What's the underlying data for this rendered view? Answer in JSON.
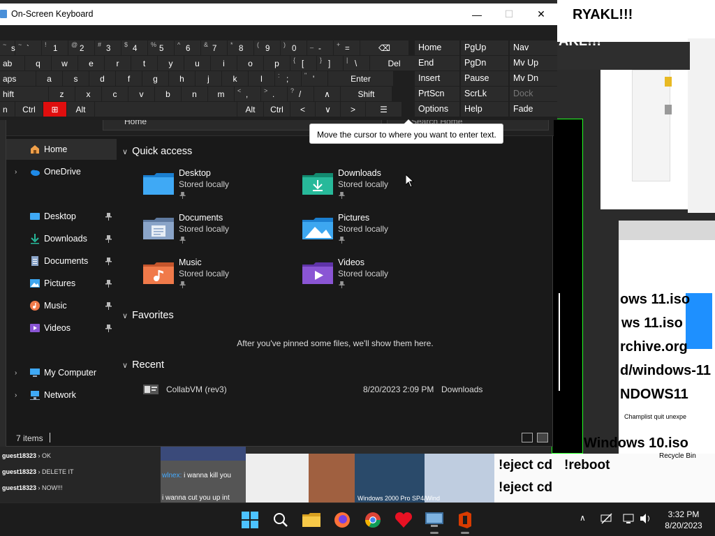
{
  "osk": {
    "title": "On-Screen Keyboard",
    "minimize": "—",
    "maximize": "☐",
    "close": "✕",
    "rows": [
      [
        {
          "s": "~",
          "m": "sc",
          "left": true
        },
        {
          "s": "~",
          "m": "`"
        },
        {
          "s": "!",
          "m": "1"
        },
        {
          "s": "@",
          "m": "2"
        },
        {
          "s": "#",
          "m": "3"
        },
        {
          "s": "$",
          "m": "4"
        },
        {
          "s": "%",
          "m": "5"
        },
        {
          "s": "^",
          "m": "6"
        },
        {
          "s": "&",
          "m": "7"
        },
        {
          "s": "*",
          "m": "8"
        },
        {
          "s": "(",
          "m": "9"
        },
        {
          "s": ")",
          "m": "0"
        },
        {
          "s": "_",
          "m": "-"
        },
        {
          "s": "+",
          "m": "="
        },
        {
          "s": "",
          "m": "⌫"
        }
      ],
      [
        {
          "s": "",
          "m": "ab",
          "left": true
        },
        {
          "s": "",
          "m": "q"
        },
        {
          "s": "",
          "m": "w"
        },
        {
          "s": "",
          "m": "e"
        },
        {
          "s": "",
          "m": "r"
        },
        {
          "s": "",
          "m": "t"
        },
        {
          "s": "",
          "m": "y"
        },
        {
          "s": "",
          "m": "u"
        },
        {
          "s": "",
          "m": "i"
        },
        {
          "s": "",
          "m": "o"
        },
        {
          "s": "",
          "m": "p"
        },
        {
          "s": "{",
          "m": "["
        },
        {
          "s": "}",
          "m": "]"
        },
        {
          "s": "|",
          "m": "\\"
        },
        {
          "s": "",
          "m": "Del"
        }
      ],
      [
        {
          "s": "",
          "m": "aps",
          "left": true
        },
        {
          "s": "",
          "m": "a"
        },
        {
          "s": "",
          "m": "s"
        },
        {
          "s": "",
          "m": "d"
        },
        {
          "s": "",
          "m": "f"
        },
        {
          "s": "",
          "m": "g"
        },
        {
          "s": "",
          "m": "h"
        },
        {
          "s": "",
          "m": "j"
        },
        {
          "s": "",
          "m": "k"
        },
        {
          "s": "",
          "m": "l"
        },
        {
          "s": ":",
          "m": ";"
        },
        {
          "s": "\"",
          "m": "'"
        },
        {
          "s": "",
          "m": "Enter"
        }
      ],
      [
        {
          "s": "",
          "m": "hift",
          "left": true
        },
        {
          "s": "",
          "m": "z"
        },
        {
          "s": "",
          "m": "x"
        },
        {
          "s": "",
          "m": "c"
        },
        {
          "s": "",
          "m": "v"
        },
        {
          "s": "",
          "m": "b"
        },
        {
          "s": "",
          "m": "n"
        },
        {
          "s": "",
          "m": "m"
        },
        {
          "s": "<",
          "m": ","
        },
        {
          "s": ">",
          "m": "."
        },
        {
          "s": "?",
          "m": "/"
        },
        {
          "s": "",
          "m": "∧"
        },
        {
          "s": "",
          "m": "Shift"
        }
      ],
      [
        {
          "s": "",
          "m": "n",
          "left": true
        },
        {
          "s": "",
          "m": "Ctrl"
        },
        {
          "s": "",
          "m": "⊞"
        },
        {
          "s": "",
          "m": "Alt"
        },
        {
          "s": "",
          "m": ""
        },
        {
          "s": "",
          "m": "Alt"
        },
        {
          "s": "",
          "m": "Ctrl"
        },
        {
          "s": "",
          "m": "<"
        },
        {
          "s": "",
          "m": "∨"
        },
        {
          "s": "",
          "m": ">"
        },
        {
          "s": "",
          "m": "☰"
        }
      ]
    ],
    "nav": [
      [
        "Home",
        "PgUp",
        "Nav"
      ],
      [
        "End",
        "PgDn",
        "Mv Up"
      ],
      [
        "Insert",
        "Pause",
        "Mv Dn"
      ],
      [
        "PrtScn",
        "ScrLk",
        "Dock"
      ],
      [
        "Options",
        "Help",
        "Fade"
      ]
    ],
    "tooltip": "Move the cursor to where you want to enter text."
  },
  "explorer": {
    "address": "Home",
    "search_placeholder": "Search Home",
    "nav": {
      "home": "Home",
      "onedrive": "OneDrive",
      "desktop": "Desktop",
      "downloads": "Downloads",
      "documents": "Documents",
      "pictures": "Pictures",
      "music": "Music",
      "videos": "Videos",
      "my_computer": "My Computer",
      "network": "Network"
    },
    "quick_access_header": "Quick access",
    "quick_access": [
      {
        "name": "Desktop",
        "sub": "Stored locally",
        "color": "#3fa9f5"
      },
      {
        "name": "Downloads",
        "sub": "Stored locally",
        "color": "#27b99a"
      },
      {
        "name": "Documents",
        "sub": "Stored locally",
        "color": "#8aa4c8"
      },
      {
        "name": "Pictures",
        "sub": "Stored locally",
        "color": "#3da7f0"
      },
      {
        "name": "Music",
        "sub": "Stored locally",
        "color": "#f07a4a"
      },
      {
        "name": "Videos",
        "sub": "Stored locally",
        "color": "#8a55d4"
      }
    ],
    "favorites_header": "Favorites",
    "favorites_empty": "After you've pinned some files, we'll show them here.",
    "recent_header": "Recent",
    "recent": [
      {
        "name": "CollabVM (rev3)",
        "date": "8/20/2023 2:09 PM",
        "location": "Downloads"
      }
    ],
    "status_count": "7 items"
  },
  "background": {
    "texts": [
      "RYAKL!!!",
      "AKL!!!",
      "ows 11.iso",
      "ws 11.iso",
      "rchive.org",
      "d/windows-11",
      "NDOWS11",
      "Windows 10.iso",
      "!eject cd",
      "!reboot",
      "!eject cd",
      "Champlist quit unexpe",
      "Recycle Bin"
    ],
    "chat": [
      {
        "user": "guest18323",
        "msg": "OK"
      },
      {
        "user": "guest18323",
        "msg": "DELETE IT"
      },
      {
        "user": "guest18323",
        "msg": "NOW!!!"
      }
    ],
    "chat2": [
      "wlnex:",
      "i wanna kill you",
      "i wanna cut you up int"
    ],
    "strip_text": "Windows 2000 Pro SP4/Wind"
  },
  "taskbar": {
    "time": "3:32 PM",
    "date": "8/20/2023"
  },
  "colors": {
    "accent": "#e00e0e",
    "explorer_bg": "#191919",
    "osk_bg": "#1f1f1f"
  }
}
